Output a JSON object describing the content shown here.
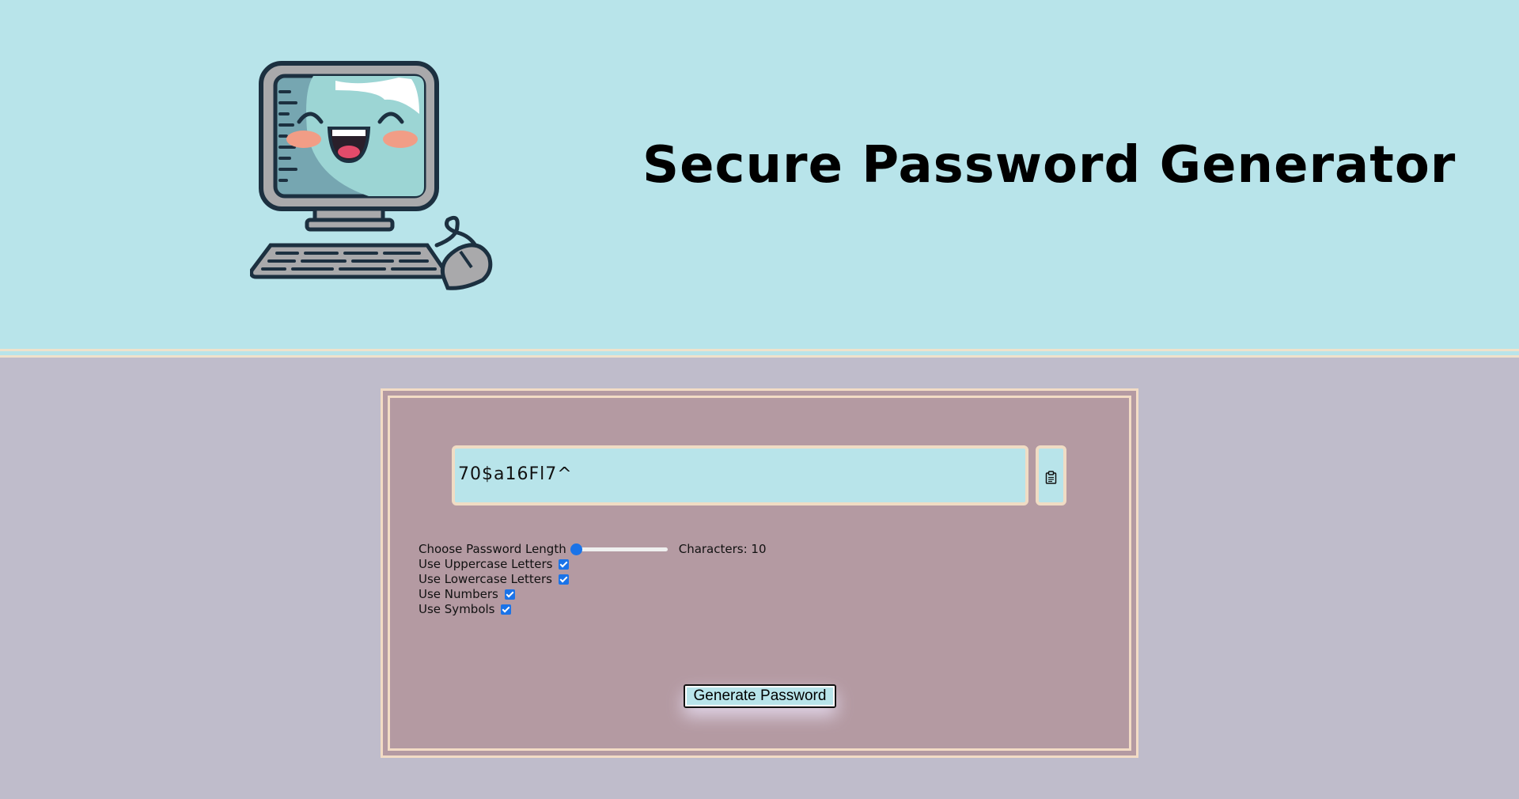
{
  "header": {
    "title": "Secure Password Generator",
    "logo_icon": "smiling-computer-icon"
  },
  "generator": {
    "password_value": "70$a16Fl7^",
    "copy_icon": "clipboard-icon",
    "length_label": "Choose Password Length",
    "length_value": 10,
    "length_slider_fraction": 0.0,
    "characters_text": "Characters: 10",
    "options": [
      {
        "label": "Use Uppercase Letters",
        "checked": true
      },
      {
        "label": "Use Lowercase Letters",
        "checked": true
      },
      {
        "label": "Use Numbers",
        "checked": true
      },
      {
        "label": "Use Symbols",
        "checked": true
      }
    ],
    "generate_label": "Generate Password"
  },
  "colors": {
    "header_bg": "#b8e4ea",
    "page_bg": "#bfbccb",
    "card_bg": "#b49aa2",
    "card_border": "#f3dcc5",
    "accent": "#1a73e8"
  }
}
